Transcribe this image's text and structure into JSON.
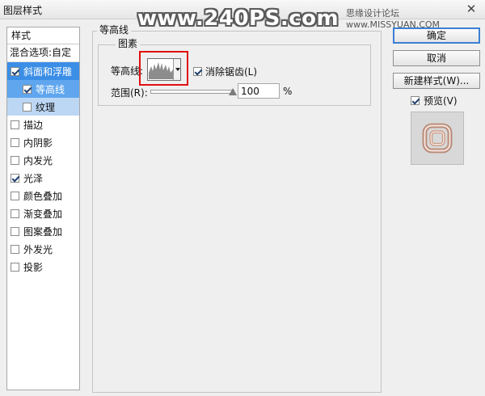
{
  "window": {
    "title": "图层样式",
    "watermark_main": "www.240PS.com",
    "watermark_site": "思缘设计论坛 www.MISSYUAN.COM",
    "close_glyph": "✕"
  },
  "styles_panel": {
    "header": "样式",
    "blend_options": "混合选项:自定",
    "items": [
      {
        "label": "斜面和浮雕",
        "checked": true
      },
      {
        "label": "等高线",
        "checked": true
      },
      {
        "label": "纹理",
        "checked": false
      },
      {
        "label": "描边",
        "checked": false
      },
      {
        "label": "内阴影",
        "checked": false
      },
      {
        "label": "内发光",
        "checked": false
      },
      {
        "label": "光泽",
        "checked": true
      },
      {
        "label": "颜色叠加",
        "checked": false
      },
      {
        "label": "渐变叠加",
        "checked": false
      },
      {
        "label": "图案叠加",
        "checked": false
      },
      {
        "label": "外发光",
        "checked": false
      },
      {
        "label": "投影",
        "checked": false
      }
    ]
  },
  "contour_group": {
    "title": "等高线",
    "subgroup_title": "图素",
    "contour_label": "等高线:",
    "anti_alias_label": "消除锯齿(L)",
    "anti_alias_checked": true,
    "range_label": "范围(R):",
    "range_value": "100",
    "range_unit": "%",
    "range_percent": 100
  },
  "buttons": {
    "ok": "确定",
    "cancel": "取消",
    "new_style": "新建样式(W)...",
    "preview_label": "预览(V)",
    "preview_checked": true
  },
  "colors": {
    "selection": "#3b8ee6",
    "highlight_box": "#e10f0f"
  }
}
